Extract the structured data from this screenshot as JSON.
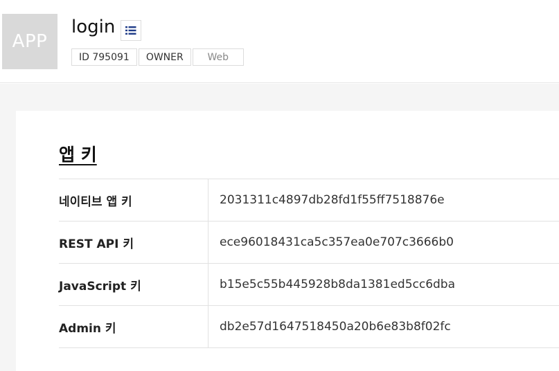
{
  "header": {
    "app_icon_text": "APP",
    "app_name": "login",
    "menu_icon": "list-icon",
    "tags": [
      "ID 795091",
      "OWNER",
      "Web"
    ]
  },
  "section": {
    "title": "앱 키"
  },
  "keys": [
    {
      "label": "네이티브 앱 키",
      "value": "2031311c4897db28fd1f55ff7518876e"
    },
    {
      "label": "REST API 키",
      "value": "ece96018431ca5c357ea0e707c3666b0"
    },
    {
      "label": "JavaScript 키",
      "value": "b15e5c55b445928b8da1381ed5cc6dba"
    },
    {
      "label": "Admin 키",
      "value": "db2e57d1647518450a20b6e83b8f02fc"
    }
  ],
  "colors": {
    "accent_icon": "#1f3c88",
    "thumb_bg": "#d9d9d9",
    "page_bg": "#f5f5f5"
  }
}
